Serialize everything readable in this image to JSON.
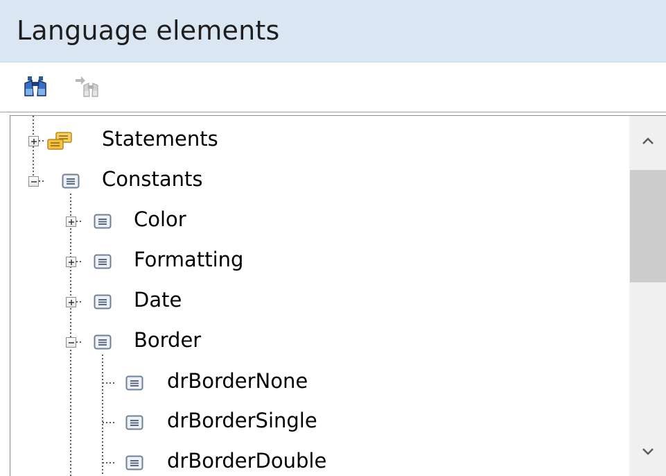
{
  "panel": {
    "title": "Language elements"
  },
  "toolbar": {
    "find_icon": "binoculars-icon",
    "find_next_icon": "binoculars-arrow-icon"
  },
  "tree": {
    "nodes": [
      {
        "label": "Statements",
        "level": 0,
        "expander": "plus",
        "icon": "folder-group-icon"
      },
      {
        "label": "Constants",
        "level": 0,
        "expander": "minus",
        "icon": "list-icon"
      },
      {
        "label": "Color",
        "level": 1,
        "expander": "plus",
        "icon": "list-icon"
      },
      {
        "label": "Formatting",
        "level": 1,
        "expander": "plus",
        "icon": "list-icon"
      },
      {
        "label": "Date",
        "level": 1,
        "expander": "plus",
        "icon": "list-icon"
      },
      {
        "label": "Border",
        "level": 1,
        "expander": "minus",
        "icon": "list-icon"
      },
      {
        "label": "drBorderNone",
        "level": 2,
        "expander": "none",
        "icon": "list-icon"
      },
      {
        "label": "drBorderSingle",
        "level": 2,
        "expander": "none",
        "icon": "list-icon"
      },
      {
        "label": "drBorderDouble",
        "level": 2,
        "expander": "none",
        "icon": "list-icon"
      }
    ]
  },
  "scrollbar": {
    "up_icon": "chevron-up-icon",
    "down_icon": "chevron-down-icon"
  },
  "colors": {
    "title_bar_bg": "#dbe6f3",
    "folder_yellow": "#f2c246",
    "list_icon_gray": "#5a6a80"
  }
}
